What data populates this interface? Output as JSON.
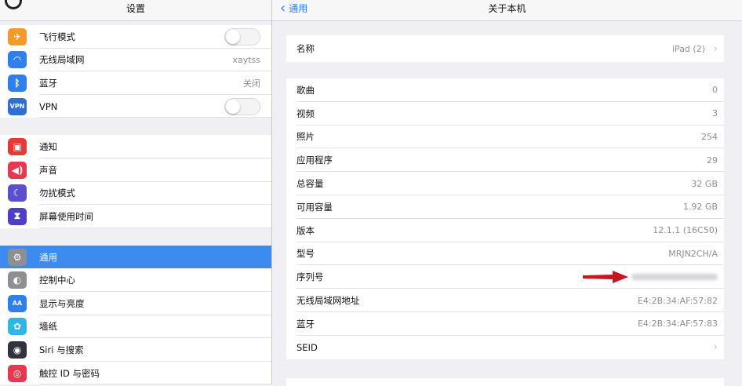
{
  "sidebar": {
    "title": "设置",
    "groups": [
      [
        {
          "label": "飞行模式",
          "icon": "airplane-icon",
          "icon_bg": "#f39a2b",
          "control": "toggle",
          "on": false
        },
        {
          "label": "无线局域网",
          "icon": "wifi-icon",
          "icon_bg": "#2f80ed",
          "value": "xaytss"
        },
        {
          "label": "蓝牙",
          "icon": "bluetooth-icon",
          "icon_bg": "#2f80ed",
          "value": "关闭"
        },
        {
          "label": "VPN",
          "icon": "vpn-icon",
          "icon_bg": "#2f6fd1",
          "icon_text": "VPN",
          "control": "toggle",
          "on": false
        }
      ],
      [
        {
          "label": "通知",
          "icon": "notifications-icon",
          "icon_bg": "#e53935"
        },
        {
          "label": "声音",
          "icon": "speaker-icon",
          "icon_bg": "#e53950"
        },
        {
          "label": "勿扰模式",
          "icon": "moon-icon",
          "icon_bg": "#5b4fd0"
        },
        {
          "label": "屏幕使用时间",
          "icon": "hourglass-icon",
          "icon_bg": "#4d3fc4"
        }
      ],
      [
        {
          "label": "通用",
          "icon": "gear-icon",
          "icon_bg": "#8e8e93",
          "selected": true
        },
        {
          "label": "控制中心",
          "icon": "control-center-icon",
          "icon_bg": "#8e8e93"
        },
        {
          "label": "显示与亮度",
          "icon": "display-icon",
          "icon_bg": "#2f80ed",
          "icon_text": "AA"
        },
        {
          "label": "墙纸",
          "icon": "wallpaper-icon",
          "icon_bg": "#2fb6e6"
        },
        {
          "label": "Siri 与搜索",
          "icon": "siri-icon",
          "icon_bg": "#333340"
        },
        {
          "label": "触控 ID 与密码",
          "icon": "fingerprint-icon",
          "icon_bg": "#e53950"
        }
      ]
    ]
  },
  "nav": {
    "back_label": "通用",
    "title": "关于本机"
  },
  "about": {
    "name_row": {
      "label": "名称",
      "value": "iPad (2)"
    },
    "rows": [
      {
        "label": "歌曲",
        "value": "0"
      },
      {
        "label": "视频",
        "value": "3"
      },
      {
        "label": "照片",
        "value": "254"
      },
      {
        "label": "应用程序",
        "value": "29"
      },
      {
        "label": "总容量",
        "value": "32 GB"
      },
      {
        "label": "可用容量",
        "value": "1.92 GB"
      },
      {
        "label": "版本",
        "value": "12.1.1 (16C50)"
      },
      {
        "label": "型号",
        "value": "MRJN2CH/A"
      },
      {
        "label": "序列号",
        "value": "",
        "blurred": true
      },
      {
        "label": "无线局域网地址",
        "value": "E4:2B:34:AF:57:82"
      },
      {
        "label": "蓝牙",
        "value": "E4:2B:34:AF:57:83"
      },
      {
        "label": "SEID",
        "value": "",
        "chevron": true
      }
    ]
  },
  "colors": {
    "accent": "#3e8bf0",
    "link": "#2a7cf2",
    "annotation_arrow": "#c8141e"
  }
}
